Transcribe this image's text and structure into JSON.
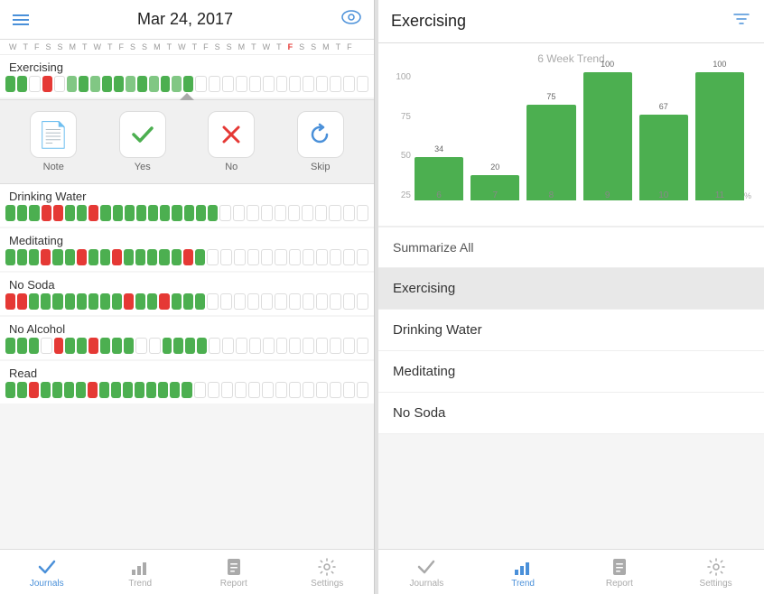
{
  "left": {
    "header": {
      "title": "Mar 24, 2017",
      "menu_icon": "☰",
      "eye_icon": "👁"
    },
    "day_labels": [
      "W",
      "T",
      "F",
      "S",
      "S",
      "M",
      "T",
      "W",
      "T",
      "F",
      "S",
      "S",
      "M",
      "T",
      "W",
      "T",
      "F",
      "S",
      "S",
      "M",
      "T",
      "W",
      "T",
      "F",
      "S",
      "S",
      "M",
      "T",
      "F"
    ],
    "habits": [
      {
        "label": "Exercising",
        "blocks": [
          "g",
          "g",
          "w",
          "r",
          "w",
          "lg",
          "g",
          "lg",
          "g",
          "g",
          "lg",
          "g",
          "lg",
          "g",
          "lg",
          "g",
          "w",
          "w",
          "w",
          "w",
          "w",
          "w",
          "w",
          "w",
          "w",
          "w",
          "w",
          "w",
          "w"
        ]
      },
      {
        "label": "Drinking Water",
        "blocks": [
          "g",
          "g",
          "g",
          "r",
          "r",
          "g",
          "g",
          "r",
          "g",
          "g",
          "g",
          "g",
          "g",
          "g",
          "g",
          "g",
          "g",
          "g",
          "w",
          "w",
          "w",
          "w",
          "w",
          "w",
          "w",
          "w",
          "w",
          "w",
          "w"
        ]
      },
      {
        "label": "Meditating",
        "blocks": [
          "g",
          "g",
          "g",
          "r",
          "g",
          "g",
          "r",
          "g",
          "g",
          "r",
          "g",
          "g",
          "g",
          "g",
          "g",
          "r",
          "g",
          "w",
          "w",
          "w",
          "w",
          "w",
          "w",
          "w",
          "w",
          "w",
          "w",
          "w",
          "w"
        ]
      },
      {
        "label": "No Soda",
        "blocks": [
          "r",
          "r",
          "g",
          "g",
          "g",
          "g",
          "g",
          "g",
          "g",
          "g",
          "r",
          "g",
          "g",
          "r",
          "g",
          "g",
          "g",
          "w",
          "w",
          "w",
          "w",
          "w",
          "w",
          "w",
          "w",
          "w",
          "w",
          "w",
          "w"
        ]
      },
      {
        "label": "No Alcohol",
        "blocks": [
          "g",
          "g",
          "g",
          "w",
          "r",
          "g",
          "g",
          "r",
          "g",
          "g",
          "g",
          "w",
          "w",
          "g",
          "g",
          "g",
          "g",
          "w",
          "w",
          "w",
          "w",
          "w",
          "w",
          "w",
          "w",
          "w",
          "w",
          "w",
          "w"
        ]
      },
      {
        "label": "Read",
        "blocks": [
          "g",
          "g",
          "r",
          "g",
          "g",
          "g",
          "g",
          "r",
          "g",
          "g",
          "g",
          "g",
          "g",
          "g",
          "g",
          "g",
          "w",
          "w",
          "w",
          "w",
          "w",
          "w",
          "w",
          "w",
          "w",
          "w",
          "w",
          "w",
          "w"
        ]
      }
    ],
    "actions": [
      {
        "label": "Note",
        "icon": "📄",
        "color": "#f5e642"
      },
      {
        "label": "Yes",
        "icon": "✓",
        "color": "#4caf50"
      },
      {
        "label": "No",
        "icon": "✗",
        "color": "#e53935"
      },
      {
        "label": "Skip",
        "icon": "↩",
        "color": "#4a90d9"
      }
    ],
    "nav": [
      {
        "label": "Journals",
        "icon": "✓",
        "active": true
      },
      {
        "label": "Trend",
        "icon": "📊",
        "active": false
      },
      {
        "label": "Report",
        "icon": "📄",
        "active": false
      },
      {
        "label": "Settings",
        "icon": "⚙",
        "active": false
      }
    ]
  },
  "right": {
    "header": {
      "title": "Exercising",
      "filter_icon": "⚙"
    },
    "chart": {
      "title": "6 Week Trend",
      "bars": [
        {
          "week": "6",
          "value": 34,
          "height_pct": 34
        },
        {
          "week": "7",
          "value": 20,
          "height_pct": 20
        },
        {
          "week": "8",
          "value": 75,
          "height_pct": 75
        },
        {
          "week": "9",
          "value": 100,
          "height_pct": 100
        },
        {
          "week": "10",
          "value": 67,
          "height_pct": 67
        },
        {
          "week": "11",
          "value": 100,
          "height_pct": 100
        }
      ],
      "y_labels": [
        "100",
        "75",
        "50",
        "25"
      ],
      "pct_label": "%"
    },
    "habit_list": [
      {
        "label": "Summarize All",
        "selected": false
      },
      {
        "label": "Exercising",
        "selected": true
      },
      {
        "label": "Drinking Water",
        "selected": false
      },
      {
        "label": "Meditating",
        "selected": false
      },
      {
        "label": "No Soda",
        "selected": false
      }
    ],
    "nav": [
      {
        "label": "Journals",
        "icon": "✓",
        "active": false
      },
      {
        "label": "Trend",
        "icon": "📊",
        "active": true
      },
      {
        "label": "Report",
        "icon": "📄",
        "active": false
      },
      {
        "label": "Settings",
        "icon": "⚙",
        "active": false
      }
    ]
  }
}
